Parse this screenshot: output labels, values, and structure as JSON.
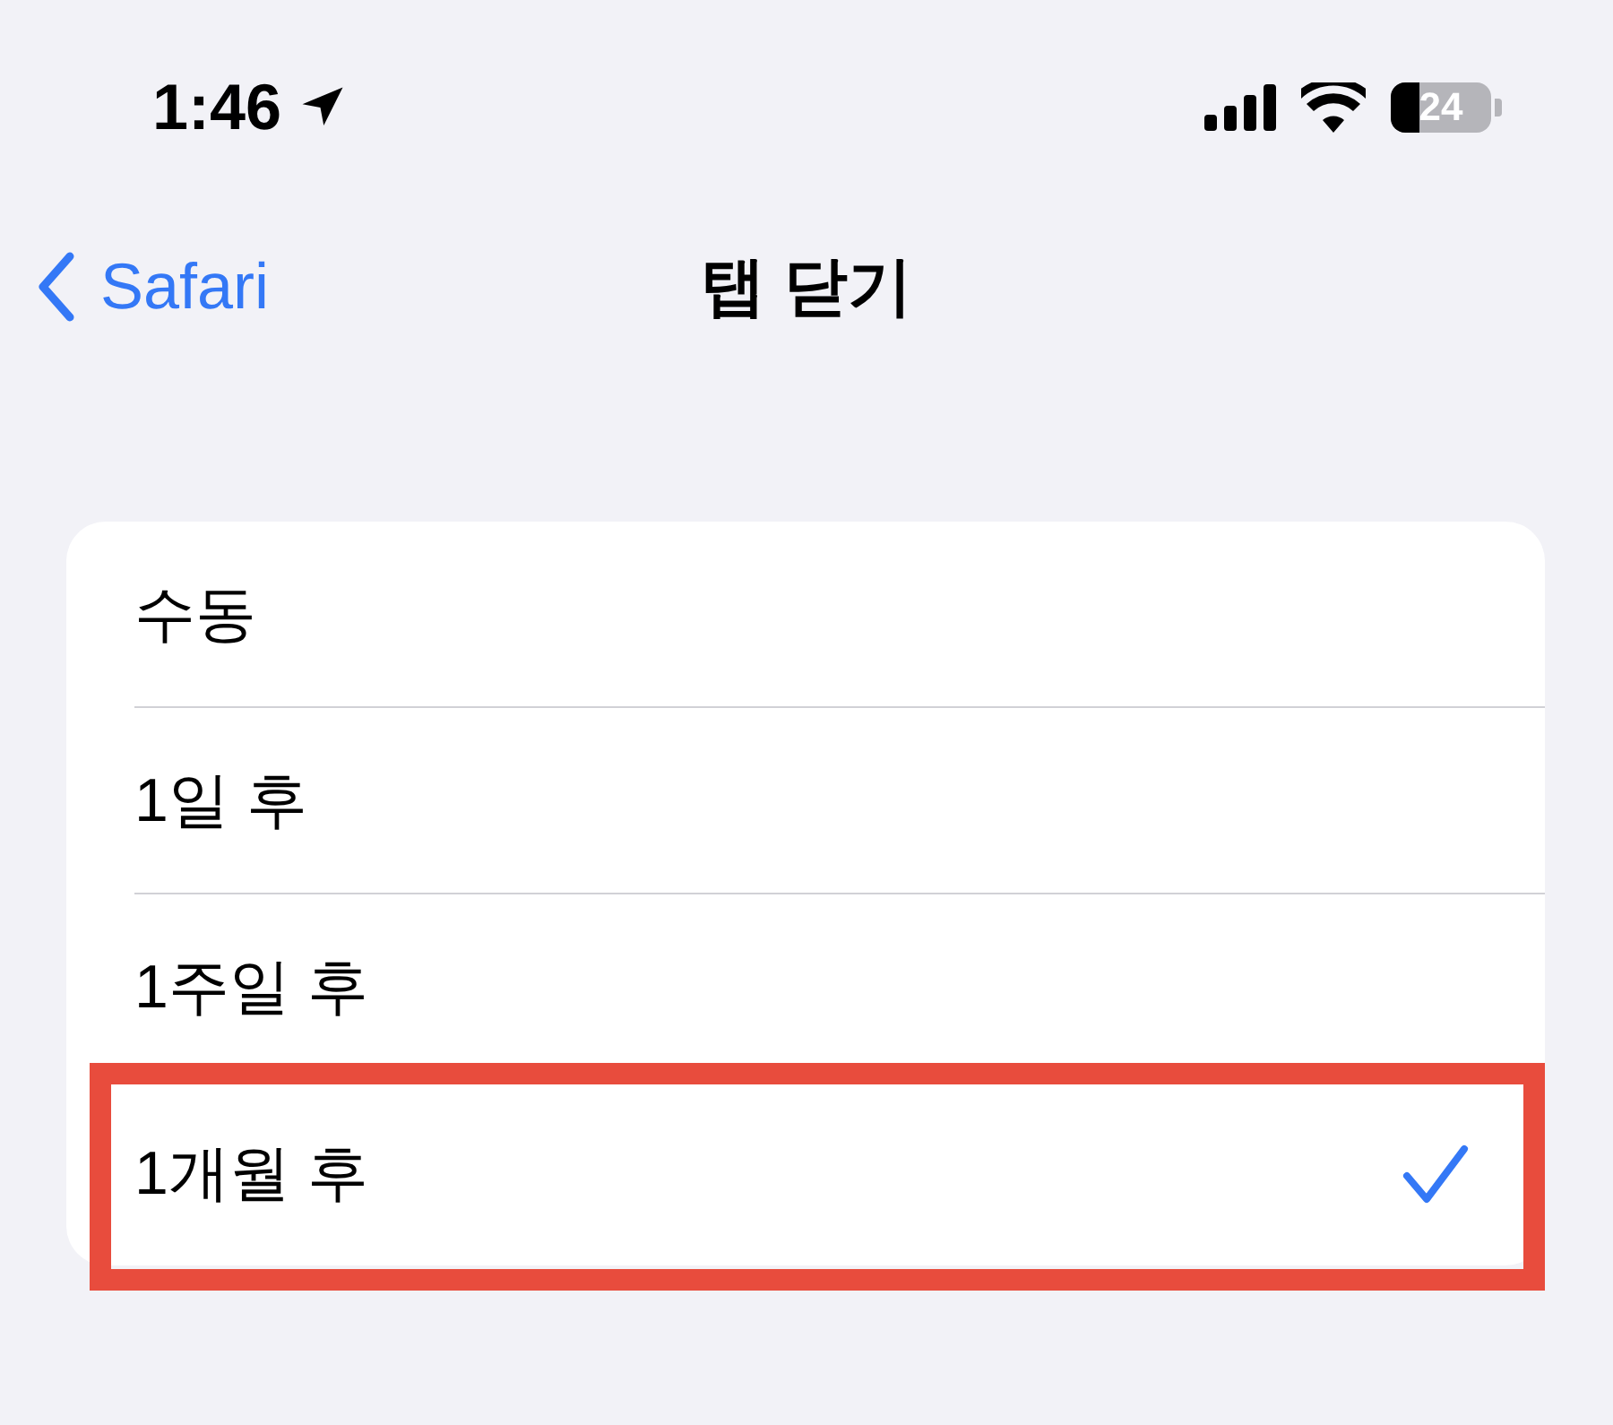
{
  "status_bar": {
    "time": "1:46",
    "battery": "24"
  },
  "nav": {
    "back": "Safari",
    "title": "탭 닫기"
  },
  "options": [
    {
      "label": "수동",
      "selected": false,
      "highlighted": false
    },
    {
      "label": "1일 후",
      "selected": false,
      "highlighted": false
    },
    {
      "label": "1주일 후",
      "selected": false,
      "highlighted": false
    },
    {
      "label": "1개월 후",
      "selected": true,
      "highlighted": true
    }
  ]
}
